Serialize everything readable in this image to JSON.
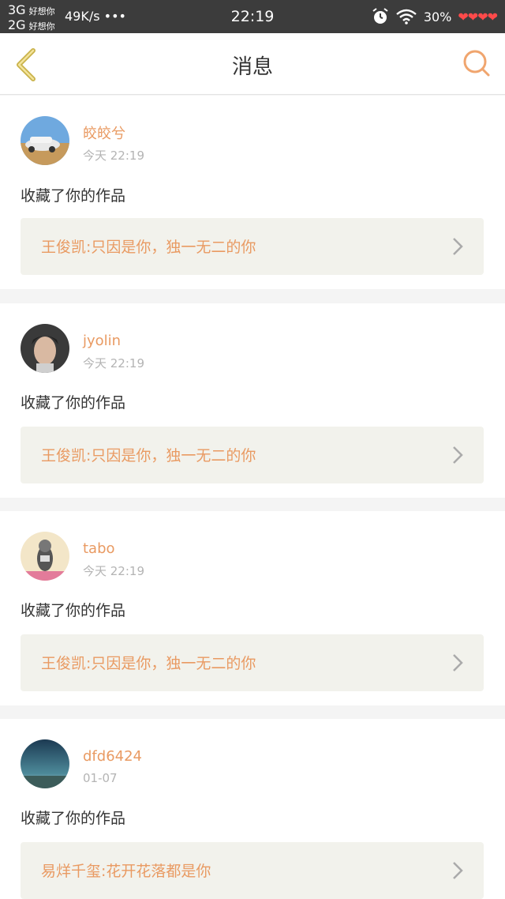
{
  "status_bar": {
    "network_1": "3G",
    "carrier_1": "好想你",
    "network_2": "2G",
    "carrier_2": "好想你",
    "speed": "49K/s •••",
    "time": "22:19",
    "battery": "30%",
    "hearts": "❤❤❤❤"
  },
  "header": {
    "title": "消息",
    "back_icon": "chevron-left-icon",
    "search_icon": "search-icon"
  },
  "messages": [
    {
      "username": "皎皎兮",
      "time": "今天 22:19",
      "action": "收藏了你的作品",
      "work_title": "王俊凯:只因是你，独一无二的你",
      "avatar": "car-desert-photo"
    },
    {
      "username": "jyolin",
      "time": "今天 22:19",
      "action": "收藏了你的作品",
      "work_title": "王俊凯:只因是你，独一无二的你",
      "avatar": "boy-portrait-photo"
    },
    {
      "username": "tabo",
      "time": "今天 22:19",
      "action": "收藏了你的作品",
      "work_title": "王俊凯:只因是你，独一无二的你",
      "avatar": "cartoon-figure-photo"
    },
    {
      "username": "dfd6424",
      "time": "01-07",
      "action": "收藏了你的作品",
      "work_title": "易烊千玺:花开花落都是你",
      "avatar": "night-sky-photo"
    }
  ],
  "colors": {
    "accent": "#e99a62",
    "back_arrow": "#c9b24a",
    "status_bar": "#3c3c3c",
    "work_bg": "#f2f2ec"
  }
}
